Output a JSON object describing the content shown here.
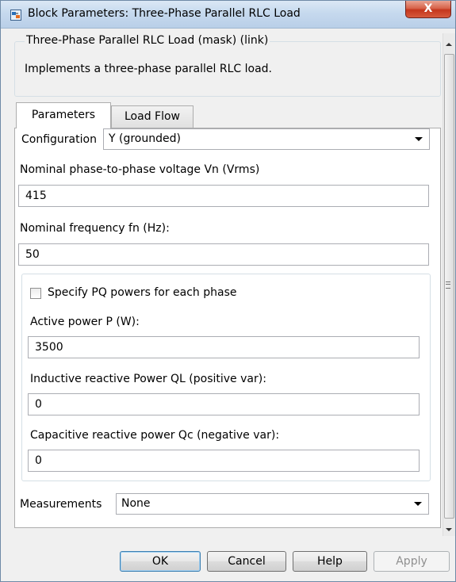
{
  "window": {
    "title": "Block Parameters: Three-Phase Parallel RLC Load",
    "close_glyph": "X"
  },
  "header": {
    "legend": "Three-Phase Parallel RLC Load (mask) (link)",
    "description": "Implements a three-phase parallel RLC load."
  },
  "tabs": [
    {
      "label": "Parameters",
      "active": true
    },
    {
      "label": "Load Flow",
      "active": false
    }
  ],
  "params": {
    "configuration_label": "Configuration",
    "configuration_value": "Y (grounded)",
    "voltage_label": "Nominal phase-to-phase voltage Vn (Vrms)",
    "voltage_value": "415",
    "frequency_label": "Nominal frequency fn (Hz):",
    "frequency_value": "50",
    "specify_pq_label": "Specify PQ powers for each phase",
    "specify_pq_checked": false,
    "active_power_label": "Active power P (W):",
    "active_power_value": "3500",
    "inductive_label": "Inductive reactive Power QL (positive var):",
    "inductive_value": "0",
    "capacitive_label": "Capacitive reactive power Qc (negative var):",
    "capacitive_value": "0",
    "measurements_label": "Measurements",
    "measurements_value": "None"
  },
  "buttons": {
    "ok": "OK",
    "cancel": "Cancel",
    "help": "Help",
    "apply": "Apply"
  },
  "colors": {
    "title_bar": "#c6d9ee",
    "close_button": "#c4361d",
    "ok_border": "#3c7fb1"
  },
  "icons": {
    "window": "simulink-block-icon",
    "close": "close-icon",
    "dropdown": "chevron-down-icon"
  }
}
